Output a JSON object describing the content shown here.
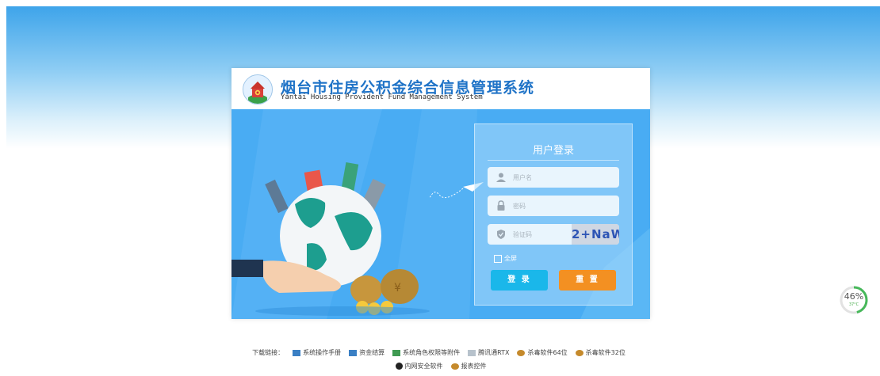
{
  "header": {
    "title_cn": "烟台市住房公积金综合信息管理系统",
    "title_en": "Yantai Housing Provident Fund Management System"
  },
  "login": {
    "title": "用户登录",
    "username_placeholder": "用户名",
    "password_placeholder": "密码",
    "captcha_placeholder": "验证码",
    "captcha_text": "2+NaW",
    "fullscreen_label": "全屏",
    "login_button": "登 录",
    "reset_button": "重 置"
  },
  "footer": {
    "download_label": "下载链接：",
    "links": [
      "系统操作手册",
      "资金结算",
      "系统角色权限等附件",
      "腾讯通RTX",
      "杀毒软件64位",
      "杀毒软件32位",
      "内网安全软件",
      "报表控件"
    ]
  },
  "widget": {
    "percent": "46%",
    "temperature": "37°C",
    "level": 0.46
  },
  "colors": {
    "title": "#1f73c7",
    "stage": "#49acf3",
    "login_button": "#1ab7ea",
    "reset_button": "#f39022"
  }
}
